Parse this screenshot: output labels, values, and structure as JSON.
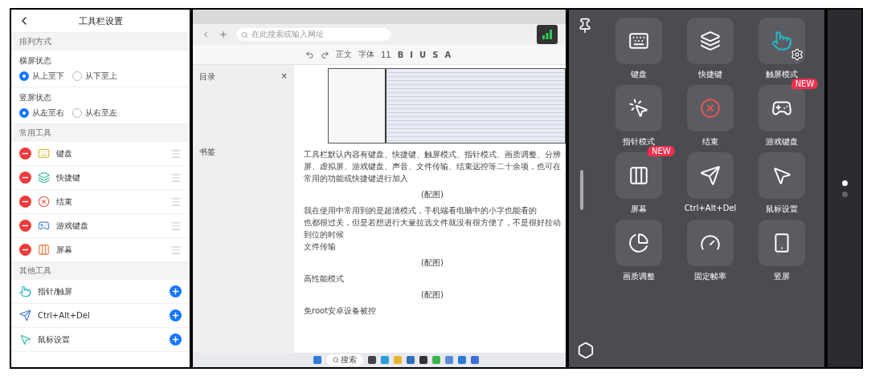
{
  "settings_panel": {
    "title": "工具栏设置",
    "sections": [
      {
        "kind": "radios",
        "title": "排列方式",
        "groups": [
          {
            "label": "横屏状态",
            "options": [
              {
                "label": "从上至下",
                "selected": true
              },
              {
                "label": "从下至上",
                "selected": false
              }
            ]
          },
          {
            "label": "竖屏状态",
            "options": [
              {
                "label": "从左至右",
                "selected": true
              },
              {
                "label": "从右至左",
                "selected": false
              }
            ]
          }
        ]
      },
      {
        "kind": "removable_tools",
        "title": "常用工具",
        "items": [
          {
            "label": "键盘",
            "kind": "keyboard"
          },
          {
            "label": "快捷键",
            "kind": "shortcut"
          },
          {
            "label": "结束",
            "kind": "end"
          },
          {
            "label": "游戏键盘",
            "kind": "gamepad"
          },
          {
            "label": "屏幕",
            "kind": "screen"
          }
        ]
      },
      {
        "kind": "addable_tools",
        "title": "其他工具",
        "items": [
          {
            "label": "指针/触屏",
            "kind": "touch"
          },
          {
            "label": "Ctrl+Alt+Del",
            "kind": "send"
          },
          {
            "label": "鼠标设置",
            "kind": "mouse"
          }
        ]
      }
    ]
  },
  "remote_desktop": {
    "address_placeholder": "在此搜索或输入网址",
    "doc_toolbar": {
      "style": "正文",
      "font": "字体",
      "size": "11",
      "format": [
        "B",
        "I",
        "U",
        "S",
        "A"
      ]
    },
    "outline": {
      "title": "目录",
      "close": "×",
      "item": "书签"
    },
    "document": [
      {
        "kind": "image"
      },
      {
        "kind": "text",
        "text": "工具栏默认内容有键盘、快捷键、触屏模式、指针模式、画质调整、分辨"
      },
      {
        "kind": "text",
        "text": "屏、虚拟屏、游戏键盘、声音、文件传输、结束远控等二十余项，也可在"
      },
      {
        "kind": "text",
        "text": "常用的功能或快捷键进行加入"
      },
      {
        "kind": "caption",
        "text": "(配图)"
      },
      {
        "kind": "text",
        "text": "我在使用中常用到的是超清模式，手机端看电脑中的小字也能看的"
      },
      {
        "kind": "text",
        "text": "也都很过关，但是若想进行大量拉选文件就没有很方便了，不是很好拉动"
      },
      {
        "kind": "text",
        "text": "到位的时候"
      },
      {
        "kind": "text",
        "text": "文件传输"
      },
      {
        "kind": "caption",
        "text": "(配图)"
      },
      {
        "kind": "text",
        "text": "高性能模式"
      },
      {
        "kind": "caption",
        "text": "(配图)"
      },
      {
        "kind": "text",
        "text": "免root安卓设备被控"
      }
    ],
    "taskbar": {
      "search": "搜索"
    }
  },
  "toolbar_overlay": {
    "tools": [
      {
        "label": "键盘",
        "kind": "keyboard"
      },
      {
        "label": "快捷键",
        "kind": "shortcut"
      },
      {
        "label": "触屏模式",
        "kind": "touch",
        "has_settings": true
      },
      {
        "label": "指针模式",
        "kind": "pointer"
      },
      {
        "label": "结束",
        "kind": "end"
      },
      {
        "label": "游戏键盘",
        "kind": "gamepad",
        "badge": "NEW"
      },
      {
        "label": "屏幕",
        "kind": "screen",
        "badge": "NEW"
      },
      {
        "label": "Ctrl+Alt+Del",
        "kind": "send"
      },
      {
        "label": "鼠标设置",
        "kind": "mouse"
      },
      {
        "label": "画质调整",
        "kind": "quality"
      },
      {
        "label": "固定帧率",
        "kind": "framerate"
      },
      {
        "label": "竖屏",
        "kind": "portrait"
      }
    ],
    "pages": [
      {
        "selected": true
      },
      {
        "selected": false
      }
    ]
  }
}
